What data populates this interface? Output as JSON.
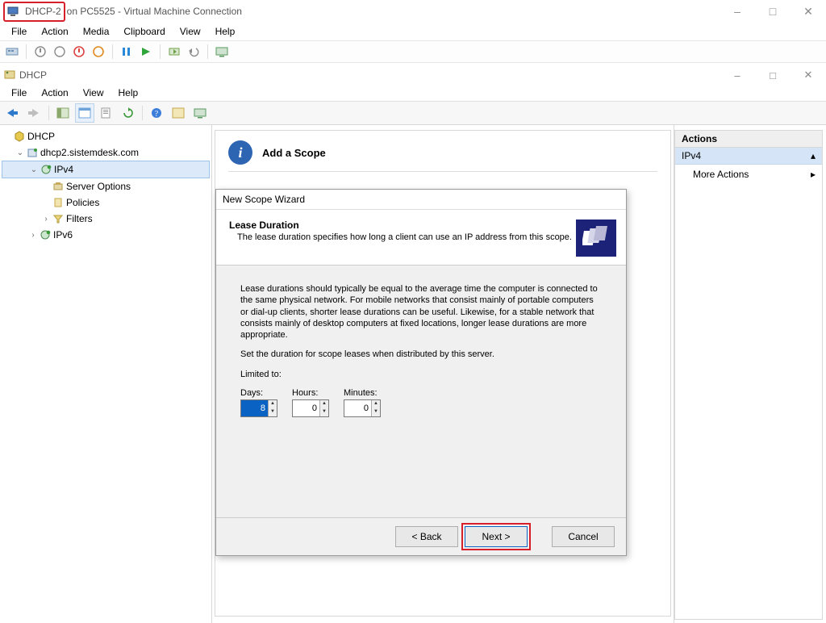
{
  "outer": {
    "title_highlight": "DHCP-2",
    "title_suffix": "on PC5525 - Virtual Machine Connection",
    "menu": [
      "File",
      "Action",
      "Media",
      "Clipboard",
      "View",
      "Help"
    ]
  },
  "inner": {
    "title": "DHCP",
    "menu": [
      "File",
      "Action",
      "View",
      "Help"
    ]
  },
  "tree": {
    "root": "DHCP",
    "server": "dhcp2.sistemdesk.com",
    "ipv4": "IPv4",
    "server_options": "Server Options",
    "policies": "Policies",
    "filters": "Filters",
    "ipv6": "IPv6"
  },
  "center": {
    "title": "Add a Scope"
  },
  "actions": {
    "header": "Actions",
    "selected": "IPv4",
    "more": "More Actions"
  },
  "wizard": {
    "window_title": "New Scope Wizard",
    "head_title": "Lease Duration",
    "head_sub": "The lease duration specifies how long a client can use an IP address from this scope.",
    "para1": "Lease durations should typically be equal to the average time the computer is connected to the same physical network. For mobile networks that consist mainly of portable computers or dial-up clients, shorter lease durations can be useful. Likewise, for a stable network that consists mainly of desktop computers at fixed locations, longer lease durations are more appropriate.",
    "para2": "Set the duration for scope leases when distributed by this server.",
    "limited_to": "Limited to:",
    "labels": {
      "days": "Days:",
      "hours": "Hours:",
      "minutes": "Minutes:"
    },
    "values": {
      "days": "8",
      "hours": "0",
      "minutes": "0"
    },
    "buttons": {
      "back": "< Back",
      "next": "Next >",
      "cancel": "Cancel"
    }
  }
}
